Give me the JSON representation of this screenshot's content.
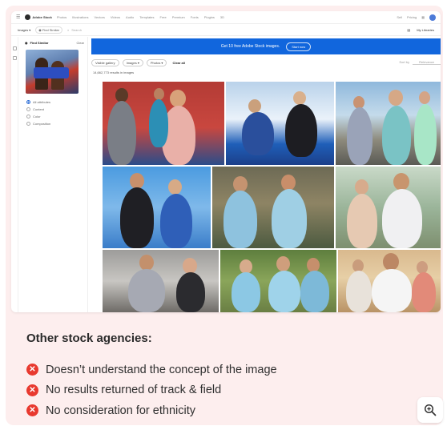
{
  "top_nav": {
    "brand": "Adobe Stock",
    "links": [
      "Photos",
      "Illustrations",
      "Vectors",
      "Videos",
      "Audio",
      "Templates",
      "Free",
      "Premium",
      "Fonts",
      "Plugins",
      "3D"
    ],
    "right": [
      "Sell",
      "Pricing"
    ]
  },
  "search": {
    "asset_type": "Images",
    "find_similar_chip": "Find Similar",
    "placeholder": "Search",
    "right_label": "My Libraries"
  },
  "panel": {
    "title": "Find Similar",
    "close": "Clear",
    "options": [
      {
        "label": "All attributes",
        "selected": true
      },
      {
        "label": "Content",
        "selected": false
      },
      {
        "label": "Color",
        "selected": false
      },
      {
        "label": "Composition",
        "selected": false
      }
    ]
  },
  "banner": {
    "text": "Get 10 free Adobe Stock images.",
    "button": "Start now"
  },
  "filters": {
    "chips": [
      "Visible gallery",
      "Images ▾",
      "Photos ▾"
    ],
    "clear": "Clear all",
    "sort_label": "Sort by",
    "sort_value": "Relevance"
  },
  "results_count": "14,662,773 results in images",
  "section": {
    "heading": "Other stock agencies:",
    "bullets": [
      "Doesn’t understand the concept of the image",
      "No results returned of track & field",
      "No consideration for ethnicity"
    ]
  },
  "icons": {
    "bullet": "x-circle-icon",
    "zoom": "zoom-in-icon"
  },
  "colors": {
    "card_bg": "#fdeeee",
    "x_red": "#e8392f",
    "banner_blue": "#1166dd"
  }
}
